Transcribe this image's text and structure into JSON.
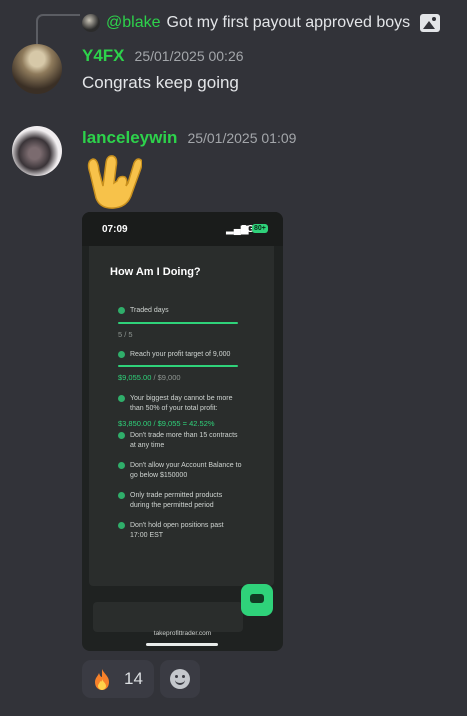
{
  "reply": {
    "username": "@blake",
    "text": "Got my first payout approved boys"
  },
  "messages": [
    {
      "username": "Y4FX",
      "timestamp": "25/01/2025 00:26",
      "text": "Congrats keep going"
    },
    {
      "username": "lanceleywin",
      "timestamp": "25/01/2025 01:09",
      "emoji": "love-you-gesture-hand"
    }
  ],
  "screenshot": {
    "status_time": "07:09",
    "status_network": "5G",
    "status_battery": "80+",
    "title": "How Am I Doing?",
    "items": [
      {
        "text": "Traded days",
        "value": "5 / 5"
      },
      {
        "text": "Reach your profit target of 9,000",
        "value_green": "$9,055.00",
        "value_rest": " / $9,000"
      },
      {
        "text": "Your biggest day cannot be more than 50% of your total profit:",
        "value_green": "$3,850.00 / $9,055 = 42.52%"
      },
      {
        "text": "Don't trade more than 15 contracts at any time"
      },
      {
        "text": "Don't allow your Account Balance to go below $150000"
      },
      {
        "text": "Only trade permitted products during the permitted period"
      },
      {
        "text": "Don't hold open positions past 17:00 EST"
      }
    ],
    "url": "takeprofittrader.com"
  },
  "reactions": [
    {
      "emoji": "fire",
      "count": "14"
    }
  ],
  "colors": {
    "background": "#323339",
    "username_green": "#2dd24b",
    "accent_green": "#2fd27a"
  }
}
